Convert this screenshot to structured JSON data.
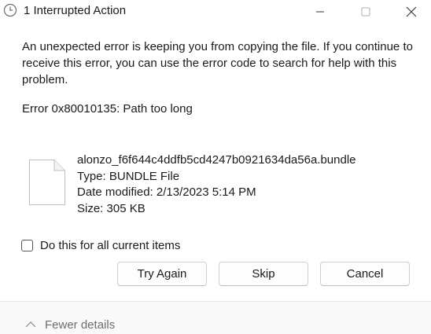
{
  "window": {
    "title": "1 Interrupted Action",
    "icon": "clock-icon"
  },
  "controls": {
    "minimize": "minimize-icon",
    "maximize": "maximize-icon",
    "close": "close-icon"
  },
  "message": {
    "body": "An unexpected error is keeping you from copying the file. If you continue to receive this error, you can use the error code to search for help with this problem.",
    "error": "Error 0x80010135: Path too long"
  },
  "file": {
    "icon": "file-icon",
    "name": "alonzo_f6f644c4ddfb5cd4247b0921634da56a.bundle",
    "type": "Type: BUNDLE File",
    "date_modified": "Date modified: 2/13/2023 5:14 PM",
    "size": "Size: 305 KB"
  },
  "checkbox": {
    "label": "Do this for all current items",
    "checked": false
  },
  "buttons": {
    "try_again": "Try Again",
    "skip": "Skip",
    "cancel": "Cancel"
  },
  "footer": {
    "details_label": "Fewer details",
    "icon": "chevron-up-icon"
  }
}
